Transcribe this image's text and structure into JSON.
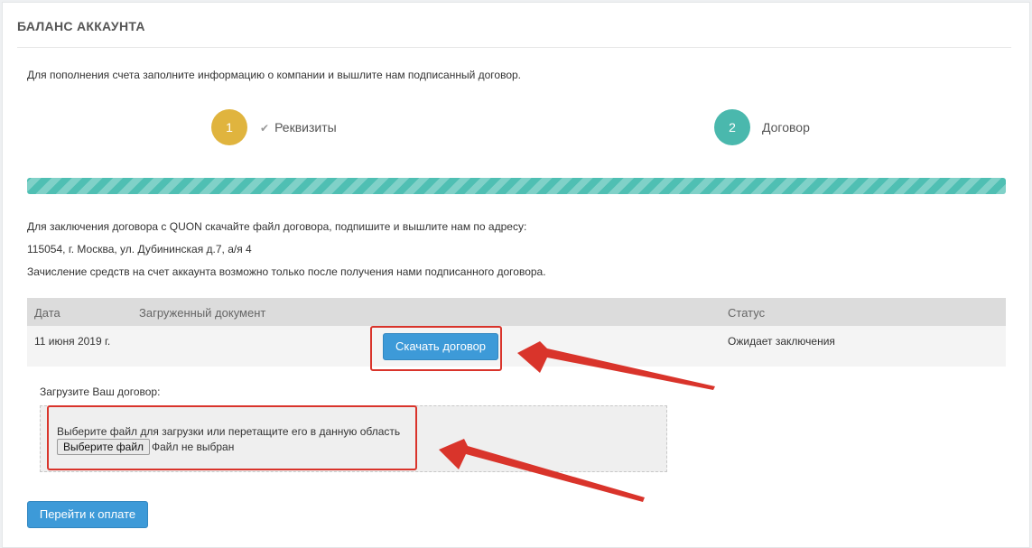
{
  "panel": {
    "title": "БАЛАНС АККАУНТА",
    "intro": "Для пополнения счета заполните информацию о компании и вышлите нам подписанный договор."
  },
  "steps": [
    {
      "number": "1",
      "label": "Реквизиты",
      "completed": true,
      "color": "#e0b43e"
    },
    {
      "number": "2",
      "label": "Договор",
      "completed": false,
      "color": "#4ab8ad"
    }
  ],
  "progress": {
    "percent": 100,
    "color": "#4fbfb3"
  },
  "info": {
    "line1": "Для заключения договора с QUON скачайте файл договора, подпишите и вышлите нам по адресу:",
    "line2": "115054, г. Москва, ул. Дубининская д.7, а/я 4",
    "line3": "Зачисление средств на счет аккаунта возможно только после получения нами подписанного договора."
  },
  "table": {
    "headers": {
      "date": "Дата",
      "document": "Загруженный документ",
      "status": "Статус"
    },
    "rows": [
      {
        "date": "11 июня 2019 г.",
        "action": "Скачать договор",
        "status": "Ожидает заключения"
      }
    ]
  },
  "upload": {
    "label": "Загрузите Ваш договор:",
    "hint": "Выберите файл для загрузки или перетащите его в данную область",
    "choose_button": "Выберите файл",
    "no_file": "Файл не выбран"
  },
  "footer": {
    "pay_button": "Перейти к оплате"
  },
  "colors": {
    "accent": "#3d9ad8",
    "annotation": "#d9342b"
  }
}
